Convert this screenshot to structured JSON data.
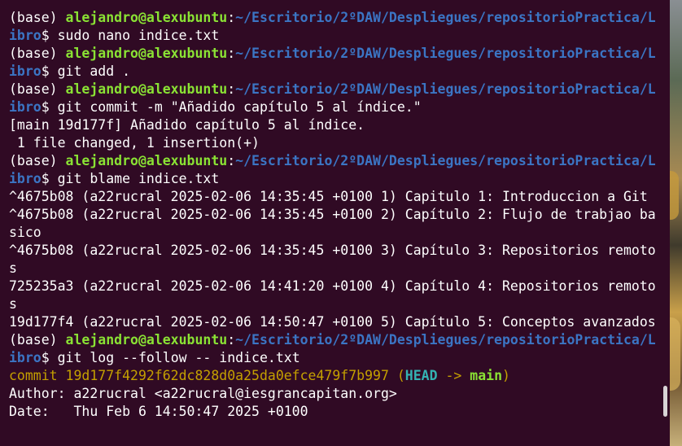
{
  "terminal": {
    "lines": [
      [
        {
          "t": "(base) ",
          "c": ""
        },
        {
          "t": "alejandro@alexubuntu",
          "c": "user"
        },
        {
          "t": ":",
          "c": ""
        },
        {
          "t": "~/Escritorio/2ºDAW/Despliegues/repositorioPractica/L",
          "c": "path"
        }
      ],
      [
        {
          "t": "ibro",
          "c": "path"
        },
        {
          "t": "$ sudo nano indice.txt",
          "c": ""
        }
      ],
      [
        {
          "t": "(base) ",
          "c": ""
        },
        {
          "t": "alejandro@alexubuntu",
          "c": "user"
        },
        {
          "t": ":",
          "c": ""
        },
        {
          "t": "~/Escritorio/2ºDAW/Despliegues/repositorioPractica/L",
          "c": "path"
        }
      ],
      [
        {
          "t": "ibro",
          "c": "path"
        },
        {
          "t": "$ git add .",
          "c": ""
        }
      ],
      [
        {
          "t": "(base) ",
          "c": ""
        },
        {
          "t": "alejandro@alexubuntu",
          "c": "user"
        },
        {
          "t": ":",
          "c": ""
        },
        {
          "t": "~/Escritorio/2ºDAW/Despliegues/repositorioPractica/L",
          "c": "path"
        }
      ],
      [
        {
          "t": "ibro",
          "c": "path"
        },
        {
          "t": "$ git commit -m \"Añadido capítulo 5 al índice.\"",
          "c": ""
        }
      ],
      [
        {
          "t": "[main 19d177f] Añadido capítulo 5 al índice.",
          "c": ""
        }
      ],
      [
        {
          "t": " 1 file changed, 1 insertion(+)",
          "c": ""
        }
      ],
      [
        {
          "t": "(base) ",
          "c": ""
        },
        {
          "t": "alejandro@alexubuntu",
          "c": "user"
        },
        {
          "t": ":",
          "c": ""
        },
        {
          "t": "~/Escritorio/2ºDAW/Despliegues/repositorioPractica/L",
          "c": "path"
        }
      ],
      [
        {
          "t": "ibro",
          "c": "path"
        },
        {
          "t": "$ git blame indice.txt",
          "c": ""
        }
      ],
      [
        {
          "t": "^4675b08 (a22rucral 2025-02-06 14:35:45 +0100 1) Capitulo 1: Introduccion a Git",
          "c": ""
        }
      ],
      [
        {
          "t": "^4675b08 (a22rucral 2025-02-06 14:35:45 +0100 2) Capítulo 2: Flujo de trabjao ba",
          "c": ""
        }
      ],
      [
        {
          "t": "sico",
          "c": ""
        }
      ],
      [
        {
          "t": "^4675b08 (a22rucral 2025-02-06 14:35:45 +0100 3) Capítulo 3: Repositorios remoto",
          "c": ""
        }
      ],
      [
        {
          "t": "s",
          "c": ""
        }
      ],
      [
        {
          "t": "725235a3 (a22rucral 2025-02-06 14:41:20 +0100 4) Capítulo 4: Repositorios remoto",
          "c": ""
        }
      ],
      [
        {
          "t": "s",
          "c": ""
        }
      ],
      [
        {
          "t": "19d177f4 (a22rucral 2025-02-06 14:50:47 +0100 5) Capítulo 5: Conceptos avanzados",
          "c": ""
        }
      ],
      [
        {
          "t": "(base) ",
          "c": ""
        },
        {
          "t": "alejandro@alexubuntu",
          "c": "user"
        },
        {
          "t": ":",
          "c": ""
        },
        {
          "t": "~/Escritorio/2ºDAW/Despliegues/repositorioPractica/L",
          "c": "path"
        }
      ],
      [
        {
          "t": "ibro",
          "c": "path"
        },
        {
          "t": "$ git log --follow -- indice.txt",
          "c": ""
        }
      ],
      [
        {
          "t": "commit 19d177f4292f62dc828d0a25da0efce479f7b997 (",
          "c": "c-yellow"
        },
        {
          "t": "HEAD",
          "c": "c-cyan"
        },
        {
          "t": " -> ",
          "c": "c-yellow"
        },
        {
          "t": "main",
          "c": "c-green"
        },
        {
          "t": ")",
          "c": "c-yellow"
        }
      ],
      [
        {
          "t": "Author: a22rucral <a22rucral@iesgrancapitan.org>",
          "c": ""
        }
      ],
      [
        {
          "t": "Date:   Thu Feb 6 14:50:47 2025 +0100",
          "c": ""
        }
      ]
    ]
  },
  "colors": {
    "background": "#300a24",
    "foreground": "#ffffff",
    "user": "#8ae234",
    "path": "#3b75c4",
    "commit_hash": "#c4a000",
    "head_ref": "#34b3b3",
    "branch": "#8ae234"
  }
}
